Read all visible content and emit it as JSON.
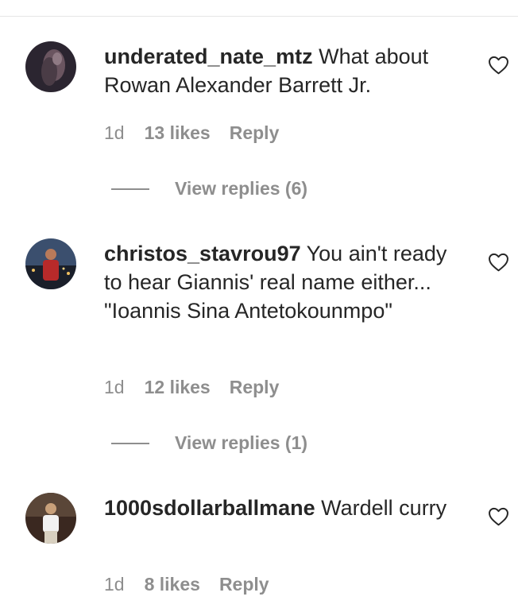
{
  "comments": [
    {
      "username": "underated_nate_mtz",
      "text": "What about Rowan Alexander Barrett Jr.",
      "time": "1d",
      "likes": "13 likes",
      "reply_label": "Reply",
      "view_replies": "View replies (6)"
    },
    {
      "username": "christos_stavrou97",
      "text": "You ain't ready to hear Giannis' real name either... \"Ioannis Sina Antetokounmpo\"",
      "time": "1d",
      "likes": "12 likes",
      "reply_label": "Reply",
      "view_replies": "View replies (1)"
    },
    {
      "username": "1000sdollarballmane",
      "text": "Wardell curry",
      "time": "1d",
      "likes": "8 likes",
      "reply_label": "Reply"
    }
  ],
  "icons": {
    "like": "heart-outline-icon",
    "avatar": "user-avatar"
  },
  "colors": {
    "text": "#262626",
    "secondary": "#8e8e8e",
    "divider": "#e6e6e6"
  }
}
